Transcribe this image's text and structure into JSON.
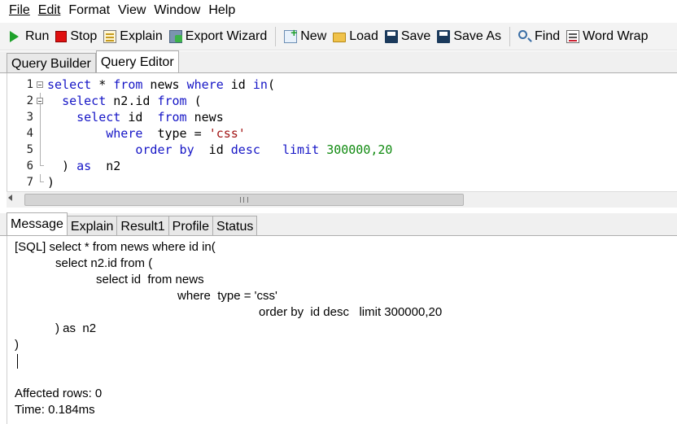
{
  "menubar": {
    "items": [
      {
        "label": "File"
      },
      {
        "label": "Edit"
      },
      {
        "label": "Format"
      },
      {
        "label": "View"
      },
      {
        "label": "Window"
      },
      {
        "label": "Help"
      }
    ]
  },
  "toolbar": {
    "run": "Run",
    "stop": "Stop",
    "explain": "Explain",
    "export_wizard": "Export Wizard",
    "new": "New",
    "load": "Load",
    "save": "Save",
    "save_as": "Save As",
    "find": "Find",
    "word_wrap": "Word Wrap",
    "icons": {
      "run": "play-icon",
      "stop": "stop-icon",
      "explain": "explain-icon",
      "export_wizard": "export-wizard-icon",
      "new": "new-query-icon",
      "load": "folder-icon",
      "save": "floppy-disk-icon",
      "save_as": "floppy-disk-as-icon",
      "find": "search-icon",
      "word_wrap": "word-wrap-icon"
    }
  },
  "editor_tabs": [
    {
      "label": "Query Builder",
      "active": false
    },
    {
      "label": "Query Editor",
      "active": true
    }
  ],
  "editor": {
    "line_numbers": [
      "1",
      "2",
      "3",
      "4",
      "5",
      "6",
      "7"
    ],
    "colors": {
      "keyword": "#1515c6",
      "string": "#a11313",
      "number": "#108a10"
    },
    "lines": [
      [
        {
          "t": "select",
          "k": "kw"
        },
        {
          "t": " * "
        },
        {
          "t": "from",
          "k": "kw"
        },
        {
          "t": " news "
        },
        {
          "t": "where",
          "k": "kw"
        },
        {
          "t": " id "
        },
        {
          "t": "in",
          "k": "kw"
        },
        {
          "t": "("
        }
      ],
      [
        {
          "t": "  "
        },
        {
          "t": "select",
          "k": "kw"
        },
        {
          "t": " n2.id "
        },
        {
          "t": "from",
          "k": "kw"
        },
        {
          "t": " ("
        }
      ],
      [
        {
          "t": "    "
        },
        {
          "t": "select",
          "k": "kw"
        },
        {
          "t": " id  "
        },
        {
          "t": "from",
          "k": "kw"
        },
        {
          "t": " news"
        }
      ],
      [
        {
          "t": "        "
        },
        {
          "t": "where",
          "k": "kw"
        },
        {
          "t": "  type = "
        },
        {
          "t": "'css'",
          "k": "str"
        }
      ],
      [
        {
          "t": "            "
        },
        {
          "t": "order by",
          "k": "kw"
        },
        {
          "t": "  id "
        },
        {
          "t": "desc",
          "k": "kw"
        },
        {
          "t": "   "
        },
        {
          "t": "limit",
          "k": "kw"
        },
        {
          "t": " "
        },
        {
          "t": "300000,20",
          "k": "num"
        }
      ],
      [
        {
          "t": "  ) "
        },
        {
          "t": "as",
          "k": "kw"
        },
        {
          "t": "  n2"
        }
      ],
      [
        {
          "t": ")"
        }
      ]
    ]
  },
  "result_tabs": [
    {
      "label": "Message",
      "active": true
    },
    {
      "label": "Explain",
      "active": false
    },
    {
      "label": "Result1",
      "active": false
    },
    {
      "label": "Profile",
      "active": false
    },
    {
      "label": "Status",
      "active": false
    }
  ],
  "message": {
    "lines": [
      "[SQL] select * from news where id in(",
      "            select n2.id from (",
      "                        select id  from news",
      "                                                where  type = 'css'",
      "                                                                        order by  id desc   limit 300000,20",
      "            ) as  n2",
      ")",
      "",
      "",
      "Affected rows: 0",
      "Time: 0.184ms"
    ]
  }
}
